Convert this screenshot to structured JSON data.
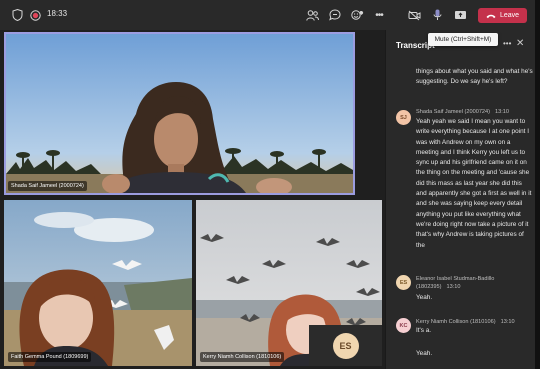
{
  "topbar": {
    "timer": "18:33",
    "leave_label": "Leave",
    "mute_tooltip": "Mute (Ctrl+Shift+M)"
  },
  "participants": [
    {
      "name": "Shada Saif Jameel (2000724)"
    },
    {
      "name": "Faith Gemma Pound (1809699)"
    },
    {
      "name": "Kerry Niamh Collison (1810106)"
    }
  ],
  "self_view": {
    "initials": "ES"
  },
  "transcript": {
    "title": "Transcript",
    "entries": [
      {
        "speaker": "",
        "initials": "",
        "time": "",
        "text": "things about what you said and what he's suggesting. Do we say he's left?"
      },
      {
        "speaker": "Shada Saif Jameel (2000724)",
        "initials": "SJ",
        "time": "13:10",
        "text": "Yeah yeah we said I mean you want to write everything because I at one point I was with Andrew on my own on a meeting and I think Kerry you left us to sync up and his girlfriend came on it on the thing on the meeting and 'cause she did this mass as last year she did this and apparently she got a first as well in it and she was saying keep every detail anything you put like everything what we're doing right now take a picture of it that's why Andrew is taking pictures of the"
      },
      {
        "speaker": "Eleanor Isabel Studman-Badillo (1802395)",
        "initials": "ES",
        "time": "13:10",
        "text": "Yeah."
      },
      {
        "speaker": "Kerry Niamh Collison (1810106)",
        "initials": "KC",
        "time": "13:10",
        "text": "It's a."
      },
      {
        "speaker": "",
        "initials": "",
        "time": "",
        "text": "Yeah."
      }
    ]
  },
  "colors": {
    "leave": "#c4314b",
    "accent": "#8b8cc7",
    "avatar_sj": "#f2c4a6",
    "avatar_es": "#f0d6b0",
    "avatar_kc": "#f6cfd2"
  }
}
